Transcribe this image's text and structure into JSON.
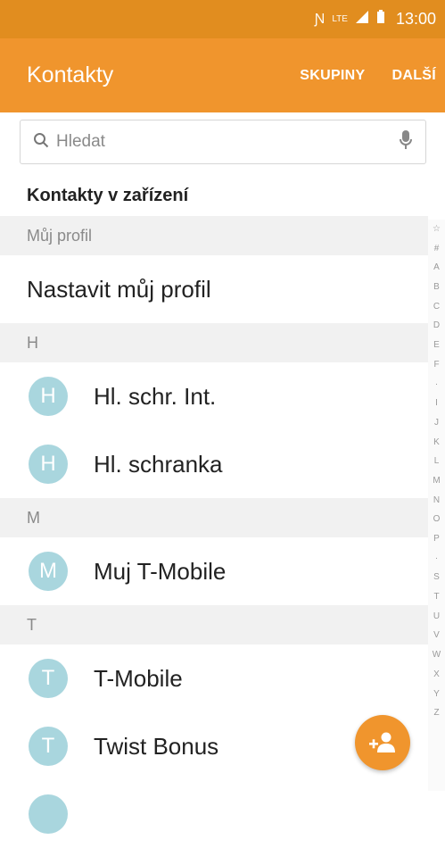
{
  "status_bar": {
    "time": "13:00",
    "icons": [
      "nfc-icon",
      "lte-icon",
      "signal-icon",
      "battery-icon"
    ],
    "lte_label": "LTE"
  },
  "app_bar": {
    "title": "Kontakty",
    "actions": [
      "SKUPINY",
      "DALŠÍ"
    ]
  },
  "search": {
    "placeholder": "Hledat"
  },
  "section": {
    "title": "Kontakty v zařízení"
  },
  "profile": {
    "header": "Můj profil",
    "setup_label": "Nastavit můj profil"
  },
  "groups": [
    {
      "letter": "H",
      "contacts": [
        {
          "initial": "H",
          "name": "Hl. schr. Int."
        },
        {
          "initial": "H",
          "name": "Hl. schranka"
        }
      ]
    },
    {
      "letter": "M",
      "contacts": [
        {
          "initial": "M",
          "name": "Muj T-Mobile"
        }
      ]
    },
    {
      "letter": "T",
      "contacts": [
        {
          "initial": "T",
          "name": "T-Mobile"
        },
        {
          "initial": "T",
          "name": "Twist Bonus"
        }
      ]
    }
  ],
  "index_letters": [
    "☆",
    "#",
    "A",
    "B",
    "C",
    "D",
    "E",
    "F",
    "·",
    "I",
    "J",
    "K",
    "L",
    "M",
    "N",
    "O",
    "P",
    "·",
    "S",
    "T",
    "U",
    "V",
    "W",
    "X",
    "Y",
    "Z"
  ],
  "colors": {
    "status_bar": "#e18d1f",
    "app_bar": "#f0952d",
    "avatar": "#a9d6de",
    "fab": "#f0952d"
  }
}
